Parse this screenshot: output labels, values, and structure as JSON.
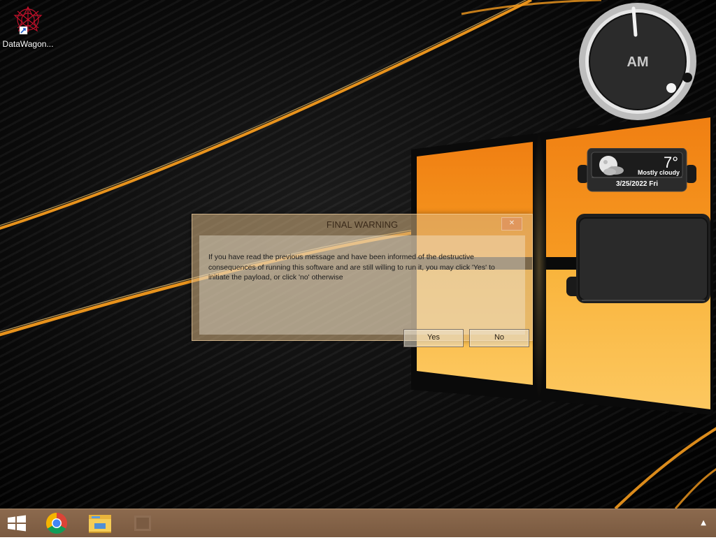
{
  "desktop_icon": {
    "label": "DataWagon..."
  },
  "clock_gadget": {
    "period": "AM"
  },
  "weather_gadget": {
    "temperature": "7°",
    "condition": "Mostly cloudy",
    "date": "3/25/2022 Fri"
  },
  "dialog": {
    "title": "FINAL WARNING",
    "close_label": "✕",
    "message": "If you have read the previous message and have been informed of the destructive consequences of running this software and are still willing to run it, you may click 'Yes' to initiate the payload, or click 'no' otherwise",
    "yes_label": "Yes",
    "no_label": "No"
  },
  "taskbar": {
    "items": [
      "start-icon",
      "chrome-icon",
      "file-explorer-icon",
      "app-icon"
    ],
    "tray_arrow": "▲"
  },
  "colors": {
    "accent_orange": "#f39a1e",
    "taskbar": "#7f5f45",
    "dialog_tint": "#d7b482"
  }
}
